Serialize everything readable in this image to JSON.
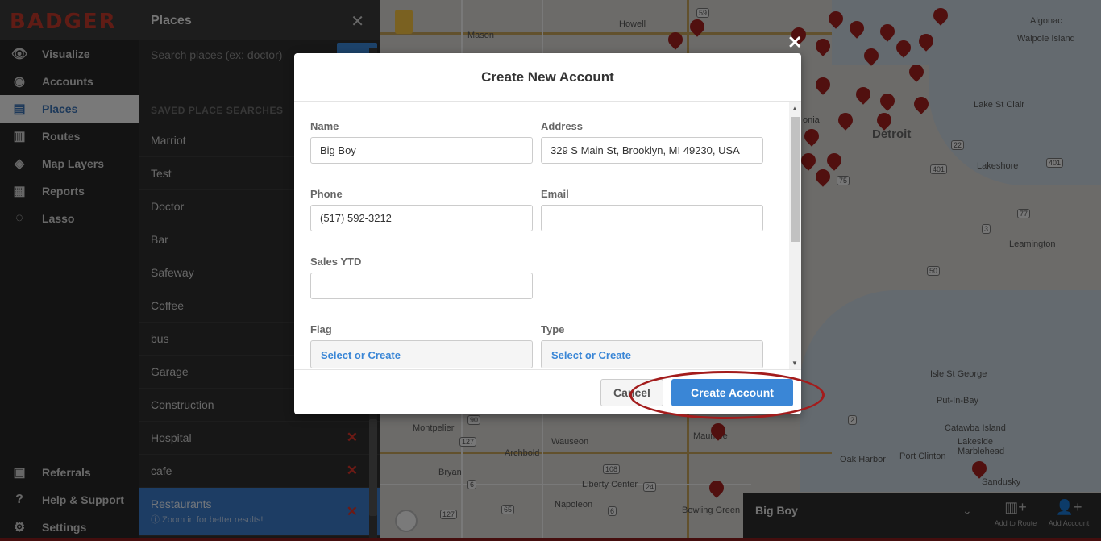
{
  "app": {
    "logo": "BADGER"
  },
  "nav": {
    "items": [
      {
        "label": "Visualize",
        "icon": "eye-icon"
      },
      {
        "label": "Accounts",
        "icon": "user-circle-icon"
      },
      {
        "label": "Places",
        "icon": "store-icon"
      },
      {
        "label": "Routes",
        "icon": "map-icon"
      },
      {
        "label": "Map Layers",
        "icon": "layers-icon"
      },
      {
        "label": "Reports",
        "icon": "chart-icon"
      },
      {
        "label": "Lasso",
        "icon": "lasso-icon"
      }
    ],
    "bottom": [
      {
        "label": "Referrals",
        "icon": "gift-icon"
      },
      {
        "label": "Help & Support",
        "icon": "help-icon"
      },
      {
        "label": "Settings",
        "icon": "gear-icon"
      }
    ]
  },
  "places": {
    "title": "Places",
    "search_placeholder": "Search places (ex: doctor)",
    "section_title": "SAVED PLACE SEARCHES",
    "items": [
      "Marriot",
      "Test",
      "Doctor",
      "Bar",
      "Safeway",
      "Coffee",
      "bus",
      "Garage",
      "Construction",
      "Hospital",
      "cafe"
    ],
    "selected": {
      "label": "Restaurants",
      "hint": "ⓘ Zoom in for better results!"
    }
  },
  "map": {
    "labels": [
      "Mason",
      "Howell",
      "Detroit",
      "Algonac",
      "Walpole Island",
      "Lake St Clair",
      "Lakeshore",
      "Leamington",
      "Montpelier",
      "Wauseon",
      "Archbold",
      "Bryan",
      "Liberty Center",
      "Napoleon",
      "Bowling Green",
      "Maumee",
      "Oak Harbor",
      "Port Clinton",
      "Sandusky",
      "Isle St George",
      "Put-In-Bay",
      "Catawba Island",
      "Lakeside Marblehead",
      "onia"
    ],
    "shields": [
      "59",
      "22",
      "401",
      "401",
      "77",
      "3",
      "50",
      "2",
      "127",
      "6",
      "108",
      "24",
      "65",
      "127",
      "6",
      "90",
      "75"
    ]
  },
  "modal": {
    "title": "Create New Account",
    "fields": {
      "name": {
        "label": "Name",
        "value": "Big Boy"
      },
      "address": {
        "label": "Address",
        "value": "329 S Main St, Brooklyn, MI 49230, USA"
      },
      "phone": {
        "label": "Phone",
        "value": "(517) 592-3212"
      },
      "email": {
        "label": "Email",
        "value": ""
      },
      "sales_ytd": {
        "label": "Sales YTD",
        "value": ""
      },
      "flag": {
        "label": "Flag",
        "value": "Select or Create"
      },
      "type": {
        "label": "Type",
        "value": "Select or Create"
      }
    },
    "cancel_label": "Cancel",
    "create_label": "Create Account"
  },
  "bottombar": {
    "account_name": "Big Boy",
    "add_to_route": "Add to Route",
    "add_account": "Add Account"
  }
}
